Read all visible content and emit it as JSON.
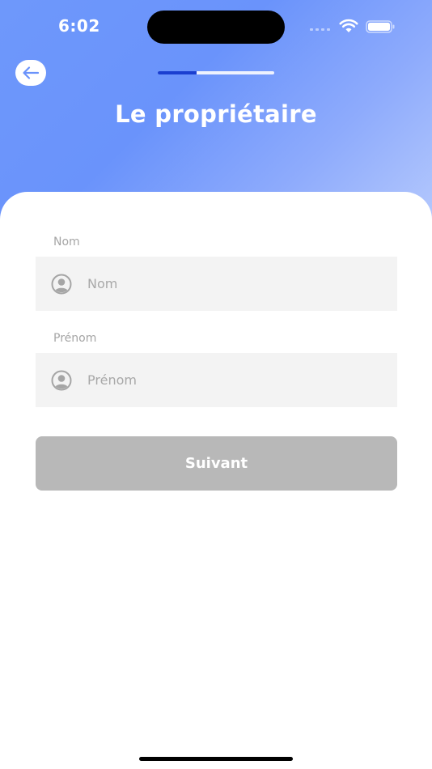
{
  "status_bar": {
    "time": "6:02",
    "icons": [
      "signal-icon",
      "wifi-icon",
      "battery-icon"
    ]
  },
  "header": {
    "back_icon": "arrow-left-icon",
    "title": "Le propriétaire",
    "progress": {
      "current_step": 1,
      "total_steps": 3,
      "fraction": 0.33
    }
  },
  "form": {
    "fields": [
      {
        "label": "Nom",
        "placeholder": "Nom",
        "value": "",
        "icon": "user-circle-icon"
      },
      {
        "label": "Prénom",
        "placeholder": "Prénom",
        "value": "",
        "icon": "user-circle-icon"
      }
    ],
    "submit_label": "Suivant"
  },
  "colors": {
    "header_gradient_start": "#6e98fb",
    "header_gradient_end": "#b8cbfd",
    "progress_fill": "#1a3fd0",
    "progress_track": "#eef2fe",
    "field_background": "#f3f3f3",
    "button_disabled": "#b8b8b8"
  }
}
